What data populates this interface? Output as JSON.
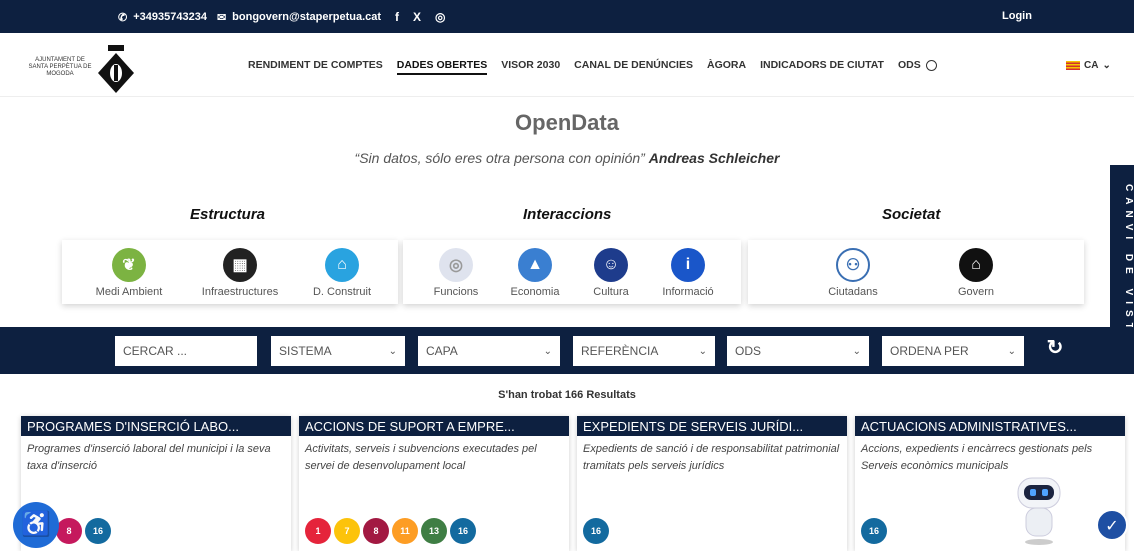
{
  "topbar": {
    "phone": "+34935743234",
    "email": "bongovern@staperpetua.cat",
    "social": [
      "f",
      "X",
      "◎"
    ],
    "login": "Login"
  },
  "header": {
    "logo_text": "AJUNTAMENT DE SANTA PERPÈTUA DE MOGODA",
    "nav": [
      "RENDIMENT DE COMPTES",
      "DADES OBERTES",
      "VISOR 2030",
      "CANAL DE DENÚNCIES",
      "ÀGORA",
      "INDICADORS DE CIUTAT",
      "ODS"
    ],
    "language": "CA"
  },
  "main": {
    "title": "OpenData",
    "quote": "“Sin datos, sólo eres otra persona con opinión”",
    "quote_author": "Andreas Schleicher",
    "side_tab": "CANVI DE VISTA"
  },
  "categories": {
    "estructura": {
      "title": "Estructura",
      "items": [
        {
          "label": "Medi Ambient",
          "color": "#7cb342",
          "icon": "leaf-icon"
        },
        {
          "label": "Infraestructures",
          "color": "#222222",
          "icon": "building-icon"
        },
        {
          "label": "D. Construit",
          "color": "#29a3e0",
          "icon": "crane-icon"
        }
      ]
    },
    "interaccions": {
      "title": "Interaccions",
      "items": [
        {
          "label": "Funcions",
          "color": "#dfe3ee",
          "icon": "gear-icon"
        },
        {
          "label": "Economia",
          "color": "#3a7fd1",
          "icon": "chart-icon"
        },
        {
          "label": "Cultura",
          "color": "#1e3c8c",
          "icon": "masks-icon"
        },
        {
          "label": "Informació",
          "color": "#1a56c9",
          "icon": "info-icon"
        }
      ]
    },
    "societat": {
      "title": "Societat",
      "items": [
        {
          "label": "Ciutadans",
          "color": "#3a6fb3",
          "icon": "people-icon"
        },
        {
          "label": "Govern",
          "color": "#111111",
          "icon": "government-icon"
        }
      ]
    }
  },
  "filters": {
    "search_placeholder": "CERCAR ...",
    "sistema": "SISTEMA",
    "capa": "CAPA",
    "referencia": "REFERÈNCIA",
    "ods": "ODS",
    "ordena": "ORDENA PER"
  },
  "results_text": "S'han trobat 166 Resultats",
  "cards": [
    {
      "title": "PROGRAMES D'INSERCIÓ LABO...",
      "desc": "Programes d'inserció laboral del municipi i la seva taxa d'inserció",
      "ods": [
        {
          "n": "5",
          "c": "#e5243b"
        },
        {
          "n": "8",
          "c": "#c5195d"
        },
        {
          "n": "16",
          "c": "#136a9f"
        }
      ]
    },
    {
      "title": "ACCIONS DE SUPORT A EMPRE...",
      "desc": "Activitats, serveis i subvencions executades pel servei de desenvolupament local",
      "ods": [
        {
          "n": "1",
          "c": "#e5243b"
        },
        {
          "n": "7",
          "c": "#fcc30b"
        },
        {
          "n": "8",
          "c": "#a21942"
        },
        {
          "n": "11",
          "c": "#fd9d24"
        },
        {
          "n": "13",
          "c": "#3f7e44"
        },
        {
          "n": "16",
          "c": "#136a9f"
        }
      ]
    },
    {
      "title": "EXPEDIENTS DE SERVEIS JURÍDI...",
      "desc": "Expedients de sanció i de responsabilitat patrimonial tramitats pels serveis jurídics",
      "ods": [
        {
          "n": "16",
          "c": "#136a9f"
        }
      ]
    },
    {
      "title": "ACTUACIONS ADMINISTRATIVES...",
      "desc": "Accions, expedients i encàrrecs gestionats pels Serveis econòmics municipals",
      "ods": [
        {
          "n": "16",
          "c": "#136a9f"
        }
      ]
    }
  ]
}
